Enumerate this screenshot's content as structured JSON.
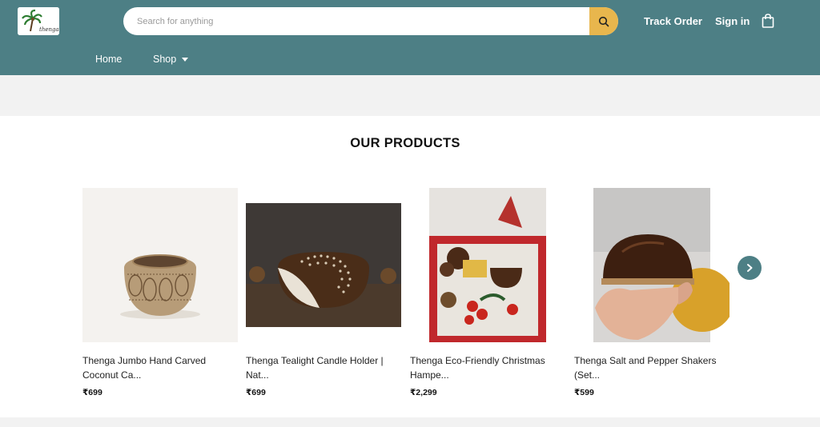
{
  "header": {
    "logo_icon": "thenga-logo",
    "search": {
      "placeholder": "Search for anything",
      "value": ""
    },
    "track_order": "Track Order",
    "sign_in": "Sign in",
    "cart_icon": "shopping-bag-icon",
    "accent": "#4d7f85",
    "search_button_color": "#e8b64d"
  },
  "nav": {
    "items": [
      {
        "label": "Home"
      },
      {
        "label": "Shop"
      }
    ]
  },
  "products_section": {
    "title": "OUR PRODUCTS",
    "products": [
      {
        "name": "Thenga Jumbo Hand Carved Coconut Ca...",
        "price": "₹699"
      },
      {
        "name": "Thenga Tealight Candle Holder | Nat...",
        "price": "₹699"
      },
      {
        "name": "Thenga Eco-Friendly Christmas Hampe...",
        "price": "₹2,299"
      },
      {
        "name": "Thenga Salt and Pepper Shakers (Set...",
        "price": "₹599"
      }
    ],
    "next_icon": "chevron-right-icon"
  }
}
